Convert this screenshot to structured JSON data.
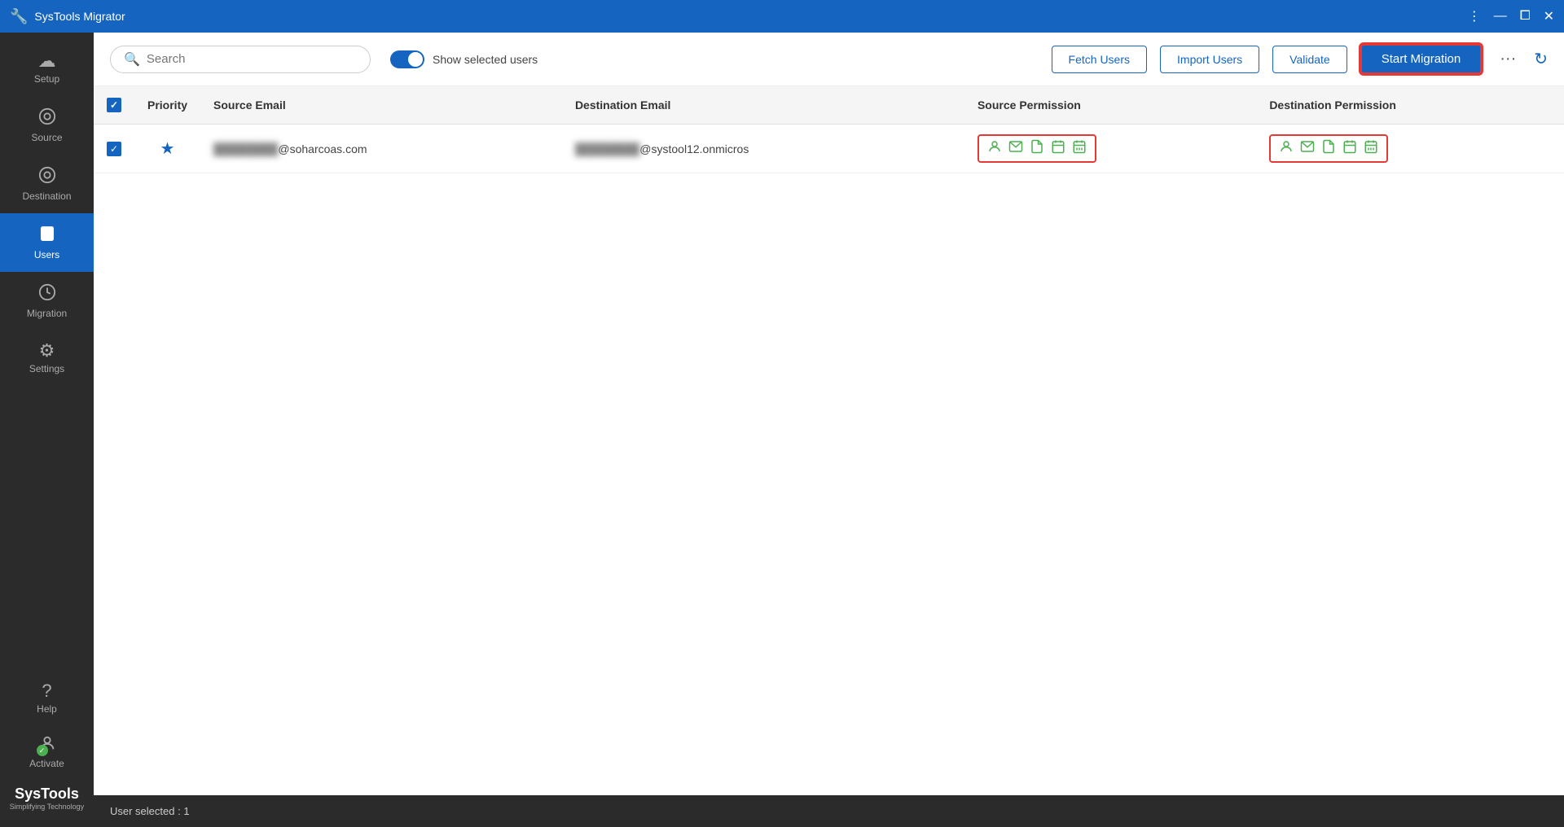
{
  "titlebar": {
    "title": "SysTools Migrator",
    "controls": [
      "⋮",
      "—",
      "⧠",
      "✕"
    ]
  },
  "sidebar": {
    "items": [
      {
        "id": "setup",
        "label": "Setup",
        "icon": "☁"
      },
      {
        "id": "source",
        "label": "Source",
        "icon": "⊙"
      },
      {
        "id": "destination",
        "label": "Destination",
        "icon": "⊙"
      },
      {
        "id": "users",
        "label": "Users",
        "icon": "👤",
        "active": true
      },
      {
        "id": "migration",
        "label": "Migration",
        "icon": "⏱"
      },
      {
        "id": "settings",
        "label": "Settings",
        "icon": "⚙"
      }
    ],
    "help_label": "Help",
    "activate_label": "Activate",
    "brand_name": "SysTools",
    "brand_sub": "Simplifying Technology"
  },
  "toolbar": {
    "search_placeholder": "Search",
    "toggle_label": "Show selected users",
    "fetch_users_label": "Fetch Users",
    "import_users_label": "Import Users",
    "validate_label": "Validate",
    "start_migration_label": "Start Migration"
  },
  "table": {
    "columns": [
      "",
      "Priority",
      "Source Email",
      "Destination Email",
      "Source Permission",
      "Destination Permission"
    ],
    "rows": [
      {
        "checked": true,
        "priority": "★",
        "source_email_blur": "████",
        "source_email_domain": "@soharcoas.com",
        "dest_email_blur": "████",
        "dest_email_domain": "@systool12.onmicros",
        "source_permissions": [
          "👤",
          "✉",
          "📄",
          "📅",
          "🗓"
        ],
        "dest_permissions": [
          "👤",
          "✉",
          "📄",
          "📅",
          "🗓"
        ]
      }
    ]
  },
  "statusbar": {
    "user_selected_text": "User selected : 1"
  }
}
